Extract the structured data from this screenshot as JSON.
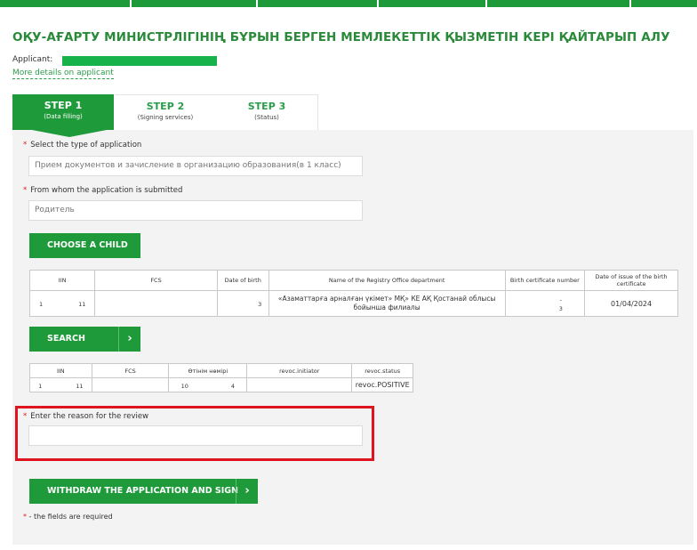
{
  "page": {
    "title": "ОҚУ-АҒАРТУ МИНИСТРЛІГІНІҢ БҰРЫН БЕРГЕН МЕМЛЕКЕТТІК ҚЫЗМЕТІН КЕРІ ҚАЙТАРЫП АЛУ",
    "applicant_label": "Applicant:",
    "more_details": "More details on applicant"
  },
  "steps": [
    {
      "label": "STEP 1",
      "sub": "(Data filling)"
    },
    {
      "label": "STEP 2",
      "sub": "(Signing services)"
    },
    {
      "label": "STEP 3",
      "sub": "(Status)"
    }
  ],
  "form": {
    "type_label": "Select the type of application",
    "type_value": "Прием документов и зачисление в организацию образования(в 1 класс)",
    "from_label": "From whom the application is submitted",
    "from_value": "Родитель",
    "choose_child": "CHOOSE A CHILD",
    "search": "SEARCH",
    "reason_label": "Enter the reason for the review",
    "reason_value": "",
    "withdraw": "WITHDRAW THE APPLICATION AND SIGN",
    "required_note": "- the fields are required",
    "required_mark": "*"
  },
  "child_table": {
    "headers": [
      "IIN",
      "FCS",
      "Date of birth",
      "Name of the Registry Office department",
      "Birth certificate number",
      "Date of issue of the birth certificate"
    ],
    "row": {
      "iin_start": "1",
      "iin_end": "11",
      "fcs": "",
      "dob_start": "",
      "dob_end": "3",
      "registry": "«Азаматтарға арналған үкімет» МҚ» КЕ АҚ Қостанай облысы бойынша филиалы",
      "cert_start": "-",
      "cert_end": "3",
      "issue_date": "01/04/2024"
    }
  },
  "revoc_table": {
    "headers": [
      "IIN",
      "FCS",
      "Өтінім нөмірі",
      "revoc.initiator",
      "revoc.status"
    ],
    "row": {
      "iin_start": "1",
      "iin_end": "11",
      "fcs": "",
      "num_start": "10",
      "num_end": "4",
      "initiator": "",
      "status": "revoc.POSITIVE"
    }
  },
  "colors": {
    "brand_green": "#1e9a3a",
    "highlight_red": "#e0141e"
  },
  "icons": {
    "button_arrow": "chevron-right-icon"
  }
}
